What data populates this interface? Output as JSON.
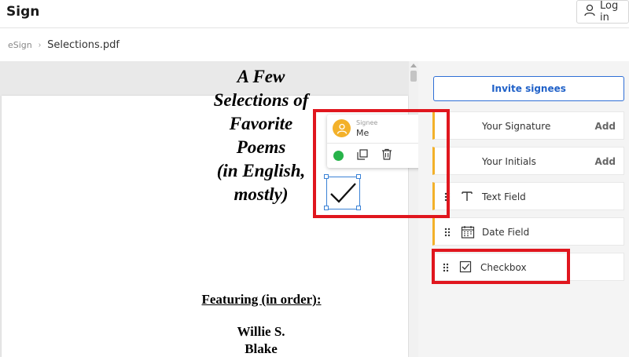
{
  "header": {
    "app_title": "Sign",
    "login_label": "Log in",
    "login_icon": "user-icon"
  },
  "breadcrumb": {
    "root": "eSign",
    "separator": "›",
    "file": "Selections.pdf"
  },
  "document": {
    "title_lines": [
      "A Few",
      "Selections of",
      "Favorite",
      "Poems",
      "(in English,",
      "mostly)"
    ],
    "featuring": "Featuring (in order):",
    "author_lines": [
      "Willie S.",
      "Blake"
    ]
  },
  "signee_popup": {
    "caption": "Signee",
    "name": "Me",
    "avatar_icon": "user-icon",
    "expand_icon": "chevron-down-icon",
    "actions": [
      "status-dot",
      "duplicate-icon",
      "trash-icon"
    ]
  },
  "panel": {
    "invite_label": "Invite signees",
    "fields": [
      {
        "label": "Your Signature",
        "action": "Add",
        "icon": "signature-icon"
      },
      {
        "label": "Your Initials",
        "action": "Add",
        "icon": "initials-icon"
      },
      {
        "label": "Text Field",
        "icon": "text-field-icon"
      },
      {
        "label": "Date Field",
        "icon": "calendar-icon"
      },
      {
        "label": "Checkbox",
        "icon": "checkbox-icon"
      }
    ]
  },
  "colors": {
    "accent_blue": "#2061c8",
    "signee_yellow": "#f3b12a",
    "status_green": "#27b34a",
    "highlight_red": "#e0161e"
  }
}
